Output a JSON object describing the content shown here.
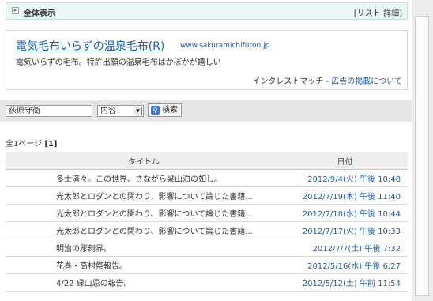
{
  "header": {
    "toggle_icon": "chevron-right-icon",
    "all_label": "全体表示",
    "list_label": "リスト",
    "detail_label": "詳細",
    "bracket_open": "[",
    "separator": "|",
    "bracket_close": "]"
  },
  "ad": {
    "title": "電気毛布いらずの温泉毛布(R)",
    "url": "www.sakuramichifuton.jp",
    "description": "電気いらずの毛布。特許出願の温泉毛布はかぽかが嬉しい",
    "interest_label": "インタレストマッチ - ",
    "interest_link": "広告の掲載について"
  },
  "search": {
    "query": "荻原守衛",
    "scope": "内容",
    "button_label": "検索",
    "button_icon": "search-icon"
  },
  "paging": {
    "prefix": "全1ページ",
    "current": "[1]"
  },
  "table": {
    "headers": {
      "title": "タイトル",
      "date": "日付"
    },
    "rows": [
      {
        "title": "多士済々。この世界、さながら梁山泊の如し。",
        "date": "2012/9/4(火) 午後 10:48"
      },
      {
        "title": "光太郎とロダンとの関わり、影響について論じた書籍...",
        "date": "2012/7/19(木) 午後 11:40"
      },
      {
        "title": "光太郎とロダンとの関わり、影響について論じた書籍...",
        "date": "2012/7/18(水) 午後 10:44"
      },
      {
        "title": "光太郎とロダンとの関わり、影響について論じた書籍...",
        "date": "2012/7/17(火) 午後 10:33"
      },
      {
        "title": "明治の彫刻界。",
        "date": "2012/7/7(土) 午後 7:32"
      },
      {
        "title": "花巻・高村祭報告。",
        "date": "2012/5/16(水) 午後 6:27"
      },
      {
        "title": "4/22 碌山忌の報告。",
        "date": "2012/5/12(土) 午前 11:54"
      }
    ]
  }
}
